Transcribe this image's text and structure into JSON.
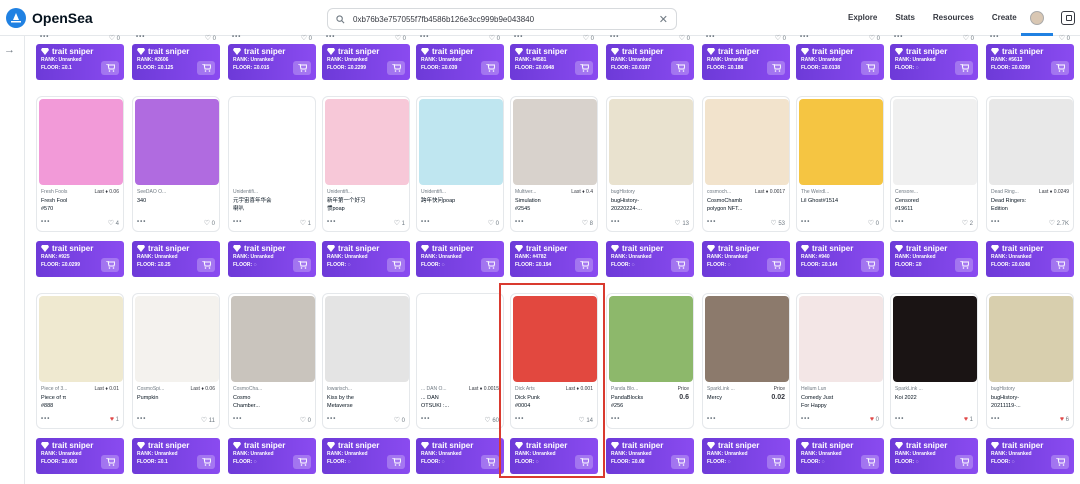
{
  "brand": "OpenSea",
  "search": {
    "value": "0xb76b3e757055f7fb4586b126e3cc999b9e043840"
  },
  "nav": [
    "Explore",
    "Stats",
    "Resources",
    "Create"
  ],
  "trait_sniper": {
    "title": "trait sniper",
    "rank_label": "RANK:",
    "floor_label": "FLOOR:",
    "rows": [
      [
        {
          "rank": "Unranked",
          "floor": "Ξ0.1"
        },
        {
          "rank": "#2606",
          "floor": "Ξ0.125"
        },
        {
          "rank": "Unranked",
          "floor": "Ξ0.015"
        },
        {
          "rank": "Unranked",
          "floor": "Ξ0.2299"
        },
        {
          "rank": "Unranked",
          "floor": "Ξ0.039"
        },
        {
          "rank": "#4581",
          "floor": "Ξ0.0948"
        },
        {
          "rank": "Unranked",
          "floor": "Ξ0.0197"
        },
        {
          "rank": "Unranked",
          "floor": "Ξ0.188"
        },
        {
          "rank": "Unranked",
          "floor": "Ξ0.0138"
        },
        {
          "rank": "Unranked",
          "floor": "◌"
        },
        {
          "rank": "#5613",
          "floor": "Ξ0.0299"
        }
      ],
      [
        {
          "rank": "#925",
          "floor": "Ξ0.0299"
        },
        {
          "rank": "Unranked",
          "floor": "Ξ0.25"
        },
        {
          "rank": "Unranked",
          "floor": "◌"
        },
        {
          "rank": "Unranked",
          "floor": "◌"
        },
        {
          "rank": "Unranked",
          "floor": "◌"
        },
        {
          "rank": "#4782",
          "floor": "Ξ0.194"
        },
        {
          "rank": "Unranked",
          "floor": "◌"
        },
        {
          "rank": "Unranked",
          "floor": "◌"
        },
        {
          "rank": "#940",
          "floor": "Ξ0.144"
        },
        {
          "rank": "Unranked",
          "floor": "Ξ0"
        },
        {
          "rank": "Unranked",
          "floor": "Ξ0.0248"
        }
      ],
      [
        {
          "rank": "Unranked",
          "floor": "Ξ0.003"
        },
        {
          "rank": "Unranked",
          "floor": "Ξ0.1"
        },
        {
          "rank": "Unranked",
          "floor": "◌"
        },
        {
          "rank": "Unranked",
          "floor": "◌"
        },
        {
          "rank": "Unranked",
          "floor": "◌"
        },
        {
          "rank": "Unranked",
          "floor": "◌"
        },
        {
          "rank": "Unranked",
          "floor": "Ξ0.08"
        },
        {
          "rank": "Unranked",
          "floor": "◌"
        },
        {
          "rank": "Unranked",
          "floor": "◌"
        },
        {
          "rank": "Unranked",
          "floor": "◌"
        },
        {
          "rank": "Unranked",
          "floor": "◌"
        }
      ]
    ]
  },
  "top_row_likes": [
    "0",
    "0",
    "0",
    "0",
    "0",
    "0",
    "0",
    "0",
    "0",
    "0",
    "0"
  ],
  "cards_row1": [
    {
      "coll": "Fresh Fools",
      "last": "Last ♦ 0.06",
      "name": "Fresh Fool\n#570",
      "likes": "4",
      "liked": false,
      "color": "#f29ad8"
    },
    {
      "coll": "SeeDAO O...",
      "last": "",
      "name": "340",
      "likes": "0",
      "liked": false,
      "color": "#b06be0"
    },
    {
      "coll": "Unidentifi...",
      "last": "",
      "name": "元宇宙喜年华会\n喇叭",
      "likes": "1",
      "liked": false,
      "color": "#ffffff"
    },
    {
      "coll": "Unidentifi...",
      "last": "",
      "name": "新年第一个好习\n惯poap",
      "likes": "1",
      "liked": false,
      "color": "#f7c8d8"
    },
    {
      "coll": "Unidentifi...",
      "last": "",
      "name": "跨年快问poap",
      "likes": "0",
      "liked": false,
      "color": "#bfe6f0"
    },
    {
      "coll": "Multiver...",
      "last": "Last ♦ 0.4",
      "name": "Simulation\n#2545",
      "likes": "8",
      "liked": false,
      "color": "#d8d2cc"
    },
    {
      "coll": "bugHistory",
      "last": "",
      "name": "bugHistory-\n20220224-...",
      "likes": "13",
      "liked": false,
      "color": "#e9e2cf"
    },
    {
      "coll": "cosmoch...",
      "last": "Last ♦ 0.0017",
      "name": "CosmoChamb\npolygon NFT...",
      "likes": "53",
      "liked": false,
      "color": "#f2e3cc"
    },
    {
      "coll": "The Weirdl...",
      "last": "",
      "name": "Lil Ghost#1514",
      "likes": "0",
      "liked": false,
      "color": "#f5c542"
    },
    {
      "coll": "Censore...",
      "last": "",
      "name": "Censored\n#19611",
      "likes": "2",
      "liked": false,
      "color": "#f0f0f0"
    },
    {
      "coll": "Dead Ring...",
      "last": "Last ♦ 0.0249",
      "name": "Dead Ringers:\nEdition",
      "likes": "2.7K",
      "liked": false,
      "color": "#e8e8e8"
    }
  ],
  "cards_row2": [
    {
      "coll": "Piece of 3...",
      "last": "Last ♦ 0.01",
      "name": "Piece of π\n#888",
      "likes": "1",
      "liked": true,
      "color": "#efe9d0"
    },
    {
      "coll": "CosmoSpi...",
      "last": "Last ♦ 0.06",
      "name": "Pumpkin",
      "likes": "11",
      "liked": false,
      "color": "#f4f2ee"
    },
    {
      "coll": "CosmoCha...",
      "last": "",
      "name": "Cosmo\nChamber...",
      "likes": "0",
      "liked": false,
      "color": "#c9c4bd"
    },
    {
      "coll": "lowarisch...",
      "last": "",
      "name": "Kiss by the\nMetaverse",
      "likes": "0",
      "liked": false,
      "color": "#e4e4e4"
    },
    {
      "coll": "... DAN O...",
      "last": "Last ♦ 0.0015",
      "name": "... DAN\nOTSUKI :...",
      "likes": "60",
      "liked": false,
      "color": "#ffffff"
    },
    {
      "coll": "Dick Arts",
      "last": "Last ♦ 0.001",
      "name": "Dick Punk\n#0004",
      "likes": "14",
      "liked": false,
      "color": "#e2483f"
    },
    {
      "coll": "Panda Blo...",
      "last": "Price",
      "name": "PandaBlocks\n#256",
      "likes": "",
      "liked": false,
      "price": "0.6",
      "color": "#8db86b"
    },
    {
      "coll": "SparkLink ...",
      "last": "Price",
      "name": "Mercy",
      "likes": "",
      "liked": false,
      "price": "0.02",
      "color": "#8c7a6c"
    },
    {
      "coll": "Helium Lun",
      "last": "",
      "name": "Comedy Just\nFor Happy",
      "likes": "0",
      "liked": true,
      "color": "#f3e6e6"
    },
    {
      "coll": "SparkLink ...",
      "last": "",
      "name": "Koi 2022",
      "likes": "1",
      "liked": true,
      "color": "#1a1414"
    },
    {
      "coll": "bugHistory",
      "last": "",
      "name": "bugHistory-\n20211119-...",
      "likes": "6",
      "liked": true,
      "color": "#d8cfae"
    }
  ],
  "colors": {
    "accent": "#2081e2",
    "sniper_purple": "#7a42e4",
    "selection": "#d93a2f",
    "liked": "#e04848"
  }
}
